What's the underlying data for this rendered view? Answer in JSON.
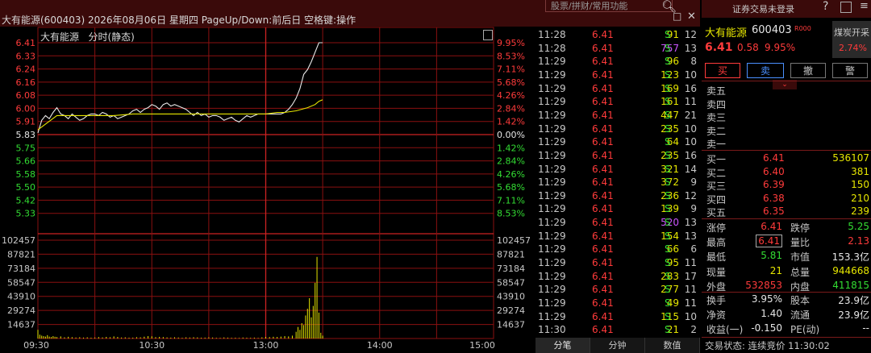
{
  "title_bar": {
    "title": "大有能源(600403) 2026年08月06日 星期四 PageUp/Down:前后日 空格键:操作",
    "search_placeholder": "股票/拼财/常用功能",
    "maximize_glyph": "□",
    "close_glyph": "✕"
  },
  "chart_header": {
    "name": "大有能源",
    "mode": "分时(静态)"
  },
  "chart_data": {
    "type": "line",
    "title": "",
    "prev_close": 5.83,
    "price_ticks": [
      "6.41",
      "6.33",
      "6.24",
      "6.16",
      "6.08",
      "6.00",
      "5.91",
      "5.83",
      "5.75",
      "5.66",
      "5.58",
      "5.50",
      "5.42",
      "5.33"
    ],
    "pct_ticks": [
      "9.95%",
      "8.53%",
      "7.11%",
      "5.68%",
      "4.26%",
      "2.84%",
      "1.42%",
      "0.00%",
      "1.42%",
      "2.84%",
      "4.26%",
      "5.68%",
      "7.11%",
      "8.53%"
    ],
    "ylim": [
      5.25,
      6.41
    ],
    "volume_ticks": [
      "102457",
      "87821",
      "73184",
      "58547",
      "43910",
      "29274",
      "14637"
    ],
    "volume_ylim": [
      0,
      102457
    ],
    "x_ticks": [
      "09:30",
      "10:30",
      "13:00",
      "14:00",
      "15:00"
    ],
    "series": [
      {
        "name": "price",
        "color": "#e8e8e8",
        "points": [
          [
            0,
            5.84
          ],
          [
            2,
            5.92
          ],
          [
            4,
            5.95
          ],
          [
            6,
            5.93
          ],
          [
            8,
            5.97
          ],
          [
            10,
            6.0
          ],
          [
            12,
            5.96
          ],
          [
            14,
            5.95
          ],
          [
            16,
            5.93
          ],
          [
            18,
            5.96
          ],
          [
            20,
            5.94
          ],
          [
            22,
            5.92
          ],
          [
            24,
            5.93
          ],
          [
            26,
            5.95
          ],
          [
            28,
            5.96
          ],
          [
            30,
            5.96
          ],
          [
            32,
            5.95
          ],
          [
            34,
            5.97
          ],
          [
            36,
            5.96
          ],
          [
            38,
            5.94
          ],
          [
            40,
            5.95
          ],
          [
            42,
            5.93
          ],
          [
            44,
            5.94
          ],
          [
            46,
            5.95
          ],
          [
            48,
            5.96
          ],
          [
            50,
            5.98
          ],
          [
            52,
            5.99
          ],
          [
            54,
            5.97
          ],
          [
            56,
            5.99
          ],
          [
            58,
            6.0
          ],
          [
            60,
            6.02
          ],
          [
            62,
            6.01
          ],
          [
            64,
            5.99
          ],
          [
            66,
            6.02
          ],
          [
            68,
            6.03
          ],
          [
            70,
            6.01
          ],
          [
            72,
            6.02
          ],
          [
            74,
            6.01
          ],
          [
            76,
            6.0
          ],
          [
            78,
            5.99
          ],
          [
            80,
            5.97
          ],
          [
            82,
            5.95
          ],
          [
            84,
            5.97
          ],
          [
            86,
            5.95
          ],
          [
            88,
            5.96
          ],
          [
            90,
            5.94
          ],
          [
            92,
            5.95
          ],
          [
            94,
            5.95
          ],
          [
            96,
            5.94
          ],
          [
            98,
            5.92
          ],
          [
            100,
            5.93
          ],
          [
            102,
            5.94
          ],
          [
            104,
            5.92
          ],
          [
            106,
            5.91
          ],
          [
            108,
            5.93
          ],
          [
            110,
            5.95
          ],
          [
            112,
            5.94
          ],
          [
            114,
            5.95
          ],
          [
            116,
            5.96
          ],
          [
            118,
            5.96
          ],
          [
            120,
            5.96
          ],
          [
            122,
            5.96
          ],
          [
            124,
            5.96
          ],
          [
            126,
            5.96
          ],
          [
            128,
            5.96
          ],
          [
            130,
            5.97
          ],
          [
            132,
            5.99
          ],
          [
            134,
            6.02
          ],
          [
            136,
            6.06
          ],
          [
            138,
            6.12
          ],
          [
            140,
            6.21
          ],
          [
            142,
            6.24
          ],
          [
            144,
            6.29
          ],
          [
            146,
            6.35
          ],
          [
            148,
            6.41
          ],
          [
            149,
            6.41
          ],
          [
            150,
            6.41
          ]
        ]
      },
      {
        "name": "avg",
        "color": "#e6e600",
        "points": [
          [
            0,
            5.86
          ],
          [
            10,
            5.95
          ],
          [
            20,
            5.95
          ],
          [
            30,
            5.95
          ],
          [
            40,
            5.95
          ],
          [
            50,
            5.96
          ],
          [
            60,
            5.96
          ],
          [
            70,
            5.96
          ],
          [
            80,
            5.96
          ],
          [
            90,
            5.96
          ],
          [
            100,
            5.96
          ],
          [
            110,
            5.96
          ],
          [
            120,
            5.96
          ],
          [
            126,
            5.97
          ],
          [
            130,
            5.97
          ],
          [
            136,
            5.98
          ],
          [
            142,
            6.0
          ],
          [
            146,
            6.02
          ],
          [
            148,
            6.04
          ],
          [
            150,
            6.05
          ]
        ]
      }
    ],
    "volume": [
      [
        0,
        9000
      ],
      [
        1,
        4000
      ],
      [
        2,
        3000
      ],
      [
        3,
        2500
      ],
      [
        4,
        2000
      ],
      [
        5,
        3500
      ],
      [
        6,
        2000
      ],
      [
        7,
        1500
      ],
      [
        8,
        2500
      ],
      [
        9,
        1800
      ],
      [
        10,
        1500
      ],
      [
        12,
        2200
      ],
      [
        14,
        1200
      ],
      [
        16,
        1800
      ],
      [
        18,
        1400
      ],
      [
        20,
        1000
      ],
      [
        22,
        1300
      ],
      [
        24,
        900
      ],
      [
        26,
        1200
      ],
      [
        28,
        800
      ],
      [
        30,
        1000
      ],
      [
        32,
        1500
      ],
      [
        34,
        1100
      ],
      [
        36,
        1700
      ],
      [
        38,
        1300
      ],
      [
        40,
        2200
      ],
      [
        42,
        1600
      ],
      [
        44,
        1000
      ],
      [
        46,
        1200
      ],
      [
        48,
        800
      ],
      [
        50,
        900
      ],
      [
        52,
        1400
      ],
      [
        54,
        1200
      ],
      [
        56,
        1900
      ],
      [
        58,
        2500
      ],
      [
        60,
        2300
      ],
      [
        62,
        1400
      ],
      [
        64,
        1700
      ],
      [
        66,
        1500
      ],
      [
        68,
        1100
      ],
      [
        70,
        900
      ],
      [
        72,
        1300
      ],
      [
        74,
        1000
      ],
      [
        76,
        700
      ],
      [
        78,
        1200
      ],
      [
        80,
        1000
      ],
      [
        82,
        1300
      ],
      [
        84,
        1100
      ],
      [
        86,
        800
      ],
      [
        88,
        900
      ],
      [
        90,
        1200
      ],
      [
        92,
        1000
      ],
      [
        94,
        700
      ],
      [
        96,
        600
      ],
      [
        98,
        1100
      ],
      [
        100,
        900
      ],
      [
        102,
        700
      ],
      [
        104,
        800
      ],
      [
        106,
        600
      ],
      [
        108,
        1000
      ],
      [
        110,
        800
      ],
      [
        112,
        700
      ],
      [
        114,
        900
      ],
      [
        116,
        600
      ],
      [
        118,
        1200
      ],
      [
        120,
        1700
      ],
      [
        122,
        1500
      ],
      [
        124,
        1800
      ],
      [
        126,
        1600
      ],
      [
        128,
        2000
      ],
      [
        130,
        2500
      ],
      [
        132,
        2200
      ],
      [
        134,
        3000
      ],
      [
        136,
        7000
      ],
      [
        137,
        12000
      ],
      [
        138,
        9000
      ],
      [
        139,
        16000
      ],
      [
        140,
        14000
      ],
      [
        141,
        24000
      ],
      [
        142,
        31000
      ],
      [
        143,
        42000
      ],
      [
        144,
        22000
      ],
      [
        145,
        34000
      ],
      [
        146,
        58000
      ],
      [
        147,
        85000
      ],
      [
        148,
        27000
      ],
      [
        149,
        6000
      ],
      [
        150,
        3000
      ]
    ]
  },
  "trades": [
    {
      "time": "11:28",
      "price": "6.41",
      "vol": "91",
      "side": "S",
      "num": "12"
    },
    {
      "time": "11:28",
      "price": "6.41",
      "vol": "757",
      "side": "S",
      "num": "13",
      "purple": true
    },
    {
      "time": "11:29",
      "price": "6.41",
      "vol": "96",
      "side": "S",
      "num": "8"
    },
    {
      "time": "11:29",
      "price": "6.41",
      "vol": "123",
      "side": "S",
      "num": "10"
    },
    {
      "time": "11:29",
      "price": "6.41",
      "vol": "169",
      "side": "S",
      "num": "16"
    },
    {
      "time": "11:29",
      "price": "6.41",
      "vol": "161",
      "side": "S",
      "num": "11"
    },
    {
      "time": "11:29",
      "price": "6.41",
      "vol": "447",
      "side": "S",
      "num": "21"
    },
    {
      "time": "11:29",
      "price": "6.41",
      "vol": "235",
      "side": "S",
      "num": "10"
    },
    {
      "time": "11:29",
      "price": "6.41",
      "vol": "64",
      "side": "S",
      "num": "10"
    },
    {
      "time": "11:29",
      "price": "6.41",
      "vol": "235",
      "side": "S",
      "num": "16"
    },
    {
      "time": "11:29",
      "price": "6.41",
      "vol": "321",
      "side": "S",
      "num": "14"
    },
    {
      "time": "11:29",
      "price": "6.41",
      "vol": "372",
      "side": "S",
      "num": "9"
    },
    {
      "time": "11:29",
      "price": "6.41",
      "vol": "236",
      "side": "S",
      "num": "12"
    },
    {
      "time": "11:29",
      "price": "6.41",
      "vol": "139",
      "side": "S",
      "num": "9"
    },
    {
      "time": "11:29",
      "price": "6.41",
      "vol": "520",
      "side": "S",
      "num": "13",
      "purple": true
    },
    {
      "time": "11:29",
      "price": "6.41",
      "vol": "154",
      "side": "S",
      "num": "13"
    },
    {
      "time": "11:29",
      "price": "6.41",
      "vol": "66",
      "side": "S",
      "num": "6"
    },
    {
      "time": "11:29",
      "price": "6.41",
      "vol": "95",
      "side": "S",
      "num": "11"
    },
    {
      "time": "11:29",
      "price": "6.41",
      "vol": "283",
      "side": "S",
      "num": "17"
    },
    {
      "time": "11:29",
      "price": "6.41",
      "vol": "277",
      "side": "S",
      "num": "11"
    },
    {
      "time": "11:29",
      "price": "6.41",
      "vol": "49",
      "side": "S",
      "num": "11"
    },
    {
      "time": "11:29",
      "price": "6.41",
      "vol": "115",
      "side": "S",
      "num": "10"
    },
    {
      "time": "11:30",
      "price": "6.41",
      "vol": "21",
      "side": "S",
      "num": "2"
    }
  ],
  "trade_tabs": [
    "分笔",
    "分钟",
    "数值"
  ],
  "right_panel": {
    "top_status": "证券交易未登录",
    "stock_name": "大有能源",
    "stock_code": "600403",
    "code_badge": "R",
    "code_badge2": "000",
    "sector": "煤炭开采",
    "sector_pct": "2.74%",
    "price": "6.41",
    "change": "0.58",
    "change_pct": "9.95%",
    "buttons": {
      "buy": "买",
      "sell": "卖",
      "cancel": "撤",
      "alert": "警"
    },
    "asks": [
      {
        "label": "卖五",
        "price": "",
        "vol": ""
      },
      {
        "label": "卖四",
        "price": "",
        "vol": ""
      },
      {
        "label": "卖三",
        "price": "",
        "vol": ""
      },
      {
        "label": "卖二",
        "price": "",
        "vol": ""
      },
      {
        "label": "卖一",
        "price": "",
        "vol": ""
      }
    ],
    "bids": [
      {
        "label": "买一",
        "price": "6.41",
        "vol": "536107"
      },
      {
        "label": "买二",
        "price": "6.40",
        "vol": "381"
      },
      {
        "label": "买三",
        "price": "6.39",
        "vol": "150"
      },
      {
        "label": "买四",
        "price": "6.38",
        "vol": "210"
      },
      {
        "label": "买五",
        "price": "6.35",
        "vol": "239"
      }
    ],
    "stats": [
      {
        "l1": "涨停",
        "v1": "6.41",
        "c1": "red",
        "l2": "跌停",
        "v2": "5.25",
        "c2": "grn"
      },
      {
        "l1": "最高",
        "v1": "6.41",
        "c1": "red",
        "l2": "量比",
        "v2": "2.13",
        "c2": "red",
        "box": true
      },
      {
        "l1": "最低",
        "v1": "5.81",
        "c1": "grn",
        "l2": "市值",
        "v2": "153.3亿",
        "c2": "wht"
      },
      {
        "l1": "现量",
        "v1": "21",
        "c1": "ylw",
        "l2": "总量",
        "v2": "944668",
        "c2": "ylw"
      },
      {
        "l1": "外盘",
        "v1": "532853",
        "c1": "red",
        "l2": "内盘",
        "v2": "411815",
        "c2": "grn"
      }
    ],
    "stats2": [
      {
        "l1": "换手",
        "v1": "3.95%",
        "c1": "wht",
        "l2": "股本",
        "v2": "23.9亿",
        "c2": "wht"
      },
      {
        "l1": "净资",
        "v1": "1.40",
        "c1": "wht",
        "l2": "流通",
        "v2": "23.9亿",
        "c2": "wht"
      },
      {
        "l1": "收益(一)",
        "v1": "-0.150",
        "c1": "wht",
        "l2": "PE(动)",
        "v2": "--",
        "c2": "wht"
      }
    ],
    "trade_status": "交易状态: 连续竞价 11:30:02"
  }
}
